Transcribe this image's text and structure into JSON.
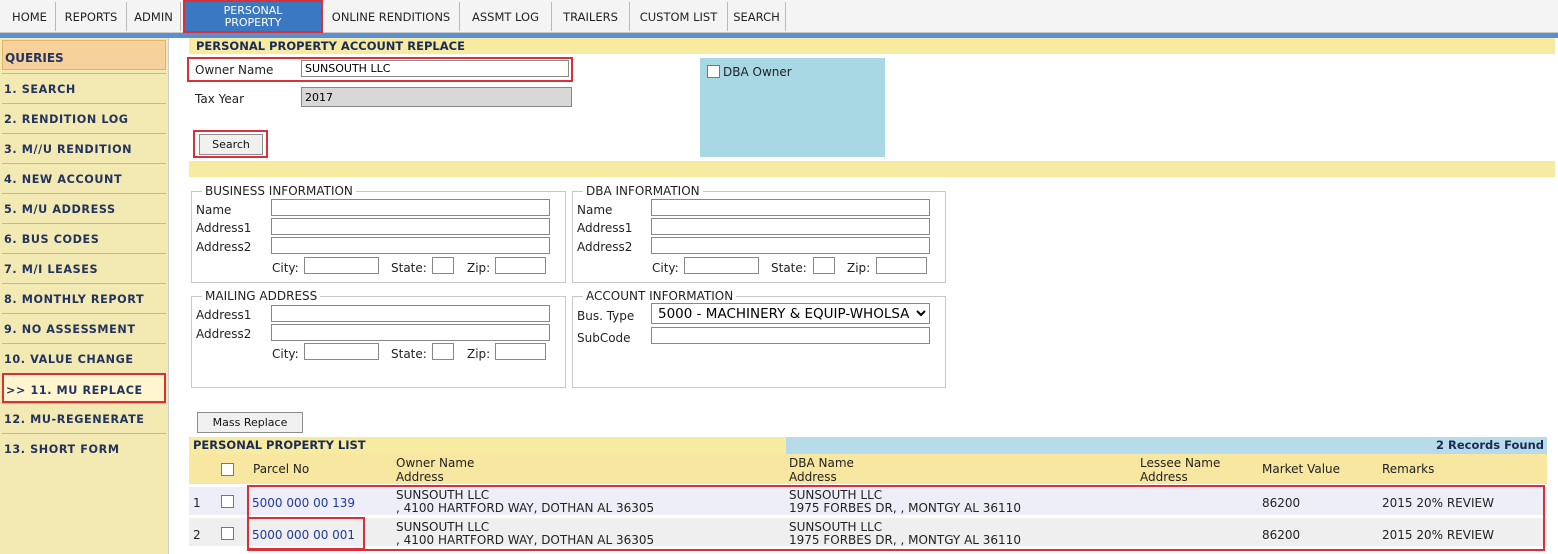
{
  "nav": {
    "tabs": [
      "HOME",
      "REPORTS",
      "ADMIN",
      "PERSONAL PROPERTY",
      "ONLINE RENDITIONS",
      "ASSMT LOG",
      "TRAILERS",
      "CUSTOM LIST",
      "SEARCH"
    ],
    "active_line1": "PERSONAL",
    "active_line2": "PROPERTY"
  },
  "sidebar": {
    "title": "QUERIES",
    "items": [
      "1. SEARCH",
      "2. RENDITION LOG",
      "3. M//U RENDITION",
      "4. NEW ACCOUNT",
      "5. M/U ADDRESS",
      "6. BUS CODES",
      "7. M/I LEASES",
      "8. MONTHLY REPORT",
      "9. NO ASSESSMENT",
      "10. VALUE CHANGE",
      ">> 11. MU REPLACE",
      "12. MU-REGENERATE",
      "13. SHORT FORM"
    ]
  },
  "form": {
    "title": "PERSONAL PROPERTY ACCOUNT REPLACE",
    "owner_label": "Owner Name",
    "owner_value": "SUNSOUTH LLC",
    "tax_year_label": "Tax Year",
    "tax_year_value": "2017",
    "dba_owner_label": "DBA Owner",
    "search_button": "Search"
  },
  "business": {
    "legend": "BUSINESS INFORMATION",
    "name": "Name",
    "address1": "Address1",
    "address2": "Address2",
    "city": "City:",
    "state": "State:",
    "zip": "Zip:"
  },
  "dba": {
    "legend": "DBA INFORMATION",
    "name": "Name",
    "address1": "Address1",
    "address2": "Address2",
    "city": "City:",
    "state": "State:",
    "zip": "Zip:"
  },
  "mailing": {
    "legend": "MAILING ADDRESS",
    "address1": "Address1",
    "address2": "Address2",
    "city": "City:",
    "state": "State:",
    "zip": "Zip:"
  },
  "account": {
    "legend": "ACCOUNT INFORMATION",
    "bus_type_label": "Bus. Type",
    "bus_type_value": "5000 - MACHINERY & EQUIP-WHOLSA",
    "subcode_label": "SubCode"
  },
  "mass_replace_button": "Mass Replace",
  "list": {
    "title": "PERSONAL PROPERTY LIST",
    "records": "2 Records Found",
    "headers": {
      "parcel": "Parcel No",
      "owner_name": "Owner Name",
      "owner_address": "Address",
      "dba_name": "DBA Name",
      "dba_address": "Address",
      "lessee_name": "Lessee Name",
      "lessee_address": "Address",
      "market_value": "Market Value",
      "remarks": "Remarks"
    },
    "rows": [
      {
        "num": "1",
        "parcel": "5000 000 00 139",
        "owner_name": "SUNSOUTH LLC",
        "owner_address": ", 4100 HARTFORD WAY, DOTHAN AL 36305",
        "dba_name": "SUNSOUTH LLC",
        "dba_address": "1975 FORBES DR, , MONTGY AL 36110",
        "market_value": "86200",
        "remarks": "2015 20% REVIEW"
      },
      {
        "num": "2",
        "parcel": "5000 000 00 001",
        "owner_name": "SUNSOUTH LLC",
        "owner_address": ", 4100 HARTFORD WAY, DOTHAN AL 36305",
        "dba_name": "SUNSOUTH LLC",
        "dba_address": "1975 FORBES DR, , MONTGY AL 36110",
        "market_value": "86200",
        "remarks": "2015 20% REVIEW"
      }
    ]
  },
  "colors": {
    "nav_active": "#3b78c2",
    "highlight_red": "#d9303a",
    "sidebar_bg": "#f3e9b3",
    "header_bar": "#f7eba1",
    "dba_box": "#a9d8e5",
    "list_title_bar": "#b7dbe8"
  }
}
